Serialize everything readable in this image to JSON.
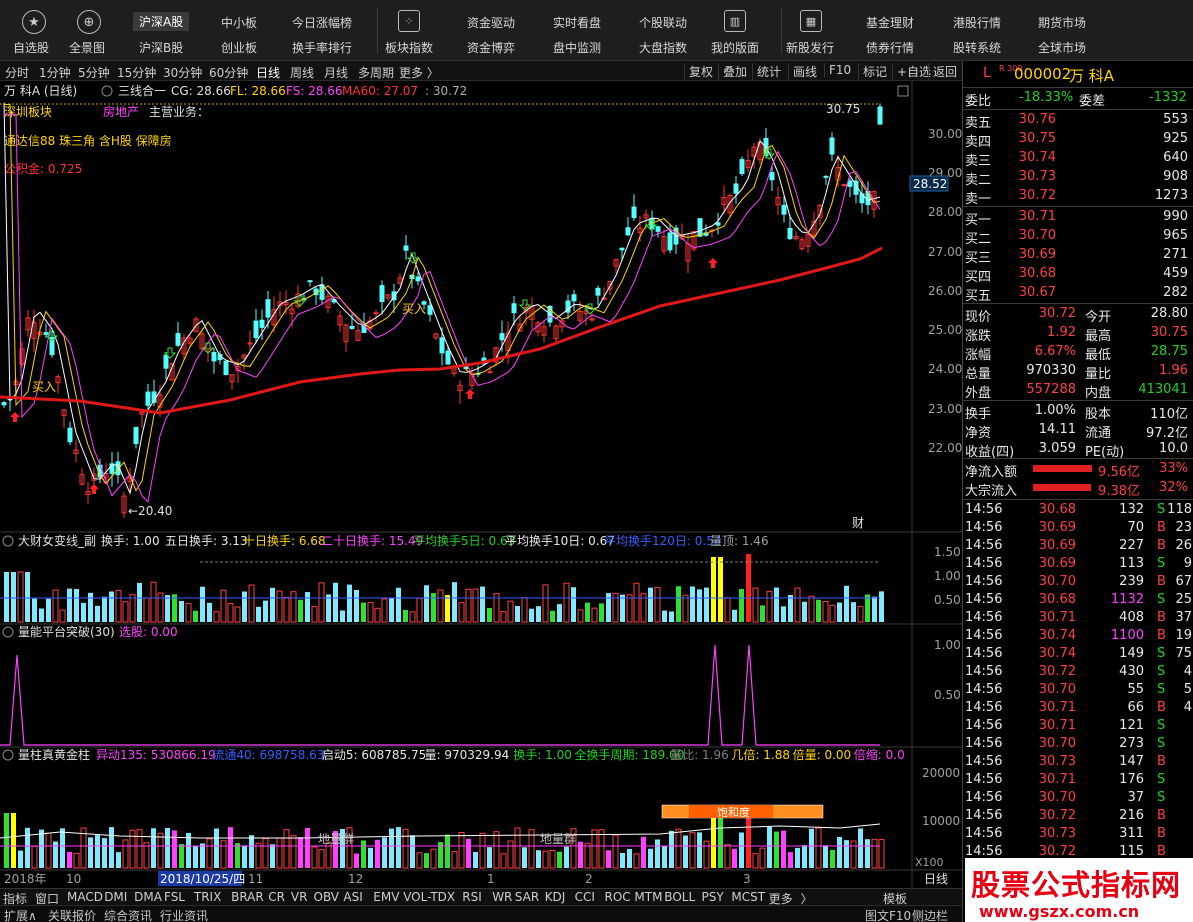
{
  "toolbar": {
    "row1": [
      "沪深A股",
      "中小板",
      "今日涨幅榜",
      "资金驱动",
      "实时看盘",
      "个股联动",
      "基金理财",
      "港股行情",
      "期货市场"
    ],
    "row2": [
      "自选股",
      "全景图",
      "沪深B股",
      "创业板",
      "换手率排行",
      "板块指数",
      "资金博弈",
      "盘中监测",
      "大盘指数",
      "我的版面",
      "新股发行",
      "债券行情",
      "股转系统",
      "全球市场"
    ]
  },
  "periods": [
    "分时",
    "1分钟",
    "5分钟",
    "15分钟",
    "30分钟",
    "60分钟",
    "日线",
    "周线",
    "月线",
    "多周期",
    "更多 〉"
  ],
  "period_active": "日线",
  "right_buttons": [
    "复权",
    "叠加",
    "统计",
    "画线",
    "F10",
    "标记",
    "+自选",
    "返回"
  ],
  "chart": {
    "name": "万 科A (日线)",
    "indicator": "三线合一",
    "cg": "CG: 28.66",
    "fl": "FL: 28.66",
    "fs": "FS: 28.66",
    "ma60": "MA60: 27.07",
    "extra": ": 30.72",
    "info_board": "深圳板块",
    "info_industry": "房地产",
    "info_business": "主营业务：",
    "info_concepts": "通达信88  珠三角  含H股  保障房",
    "info_fund": "公积金: 0.725",
    "price_axis": [
      "30.00",
      "29.00",
      "28.00",
      "27.00",
      "26.00",
      "25.00",
      "24.00",
      "23.00",
      "22.00"
    ],
    "current_price_tag": "28.52",
    "high_label": "30.75",
    "low_label": "←20.40",
    "buy_label": "买入",
    "cai_label": "财"
  },
  "panel1": {
    "title": "大财女变线_副",
    "items": [
      {
        "t": "换手: 1.00",
        "c": "#e8e8e8"
      },
      {
        "t": "五日换手: 3.13",
        "c": "#e8e8e8"
      },
      {
        "t": "十日换手: 6.68",
        "c": "#ffd400"
      },
      {
        "t": "二十日换手: 15.49",
        "c": "#ff40ff"
      },
      {
        "t": "平均换手5日: 0.63",
        "c": "#20d020"
      },
      {
        "t": "平均换手10日: 0.67",
        "c": "#e8e8e8"
      },
      {
        "t": "平均换手120日: 0.54",
        "c": "#3060ff"
      },
      {
        "t": "量顶: 1.46",
        "c": "#a0a0a0"
      }
    ],
    "axis": [
      "1.50",
      "1.00",
      "0.50"
    ]
  },
  "panel2": {
    "title": "量能平台突破(30)",
    "sel": "选股: 0.00",
    "axis": [
      "1.00",
      "0.50"
    ]
  },
  "panel3": {
    "title": "量柱真黄金柱",
    "items": [
      {
        "t": "异动135: 530866.19",
        "c": "#ff40ff"
      },
      {
        "t": "流通40: 698758.63",
        "c": "#3060ff"
      },
      {
        "t": "启动5: 608785.75",
        "c": "#e8e8e8"
      },
      {
        "t": "量: 970329.94",
        "c": "#e8e8e8"
      },
      {
        "t": "换手: 1.00",
        "c": "#20d020"
      },
      {
        "t": "全换手周期: 189.00",
        "c": "#20d020"
      },
      {
        "t": "量比: 1.96",
        "c": "#808080"
      },
      {
        "t": "几倍: 1.88",
        "c": "#ffd400"
      },
      {
        "t": "倍量: 0.00",
        "c": "#ffd400"
      },
      {
        "t": "倍缩: 0.0",
        "c": "#ff40ff"
      }
    ],
    "axis": [
      "20000",
      "10000"
    ],
    "unit": "X100",
    "sat_label": "饱和度",
    "ground_label": "地量群"
  },
  "date_axis": {
    "labels": [
      "2018年",
      "10",
      "11",
      "12",
      "1",
      "2",
      "3"
    ],
    "cursor": "2018/10/25/四",
    "period": "日线"
  },
  "bottom_tabs": [
    "指标",
    "窗口",
    "MACD",
    "DMI",
    "DMA",
    "FSL",
    "TRIX",
    "BRAR",
    "CR",
    "VR",
    "OBV",
    "ASI",
    "EMV",
    "VOL-TDX",
    "RSI",
    "WR",
    "SAR",
    "KDJ",
    "CCI",
    "ROC",
    "MTM",
    "BOLL",
    "PSY",
    "MCST",
    "更多",
    "〉",
    "模板"
  ],
  "ext_tabs": [
    "扩展∧",
    "关联报价",
    "综合资讯",
    "行业资讯"
  ],
  "ext_right": [
    "图文F10",
    "侧边栏"
  ],
  "quote": {
    "code": "000002",
    "name": "万 科A",
    "market": "L",
    "hs": "R 300",
    "weibi_label": "委比",
    "weibi": "-18.33%",
    "weicha_label": "委差",
    "weicha": "-1332",
    "asks": [
      {
        "l": "卖五",
        "p": "30.76",
        "v": "553"
      },
      {
        "l": "卖四",
        "p": "30.75",
        "v": "925"
      },
      {
        "l": "卖三",
        "p": "30.74",
        "v": "640"
      },
      {
        "l": "卖二",
        "p": "30.73",
        "v": "908"
      },
      {
        "l": "卖一",
        "p": "30.72",
        "v": "1273"
      }
    ],
    "bids": [
      {
        "l": "买一",
        "p": "30.71",
        "v": "990"
      },
      {
        "l": "买二",
        "p": "30.70",
        "v": "965"
      },
      {
        "l": "买三",
        "p": "30.69",
        "v": "271"
      },
      {
        "l": "买四",
        "p": "30.68",
        "v": "459"
      },
      {
        "l": "买五",
        "p": "30.67",
        "v": "282"
      }
    ],
    "stats1": [
      {
        "a": "现价",
        "av": "30.72",
        "ac": "red",
        "b": "今开",
        "bv": "28.80",
        "bc": "wht"
      },
      {
        "a": "涨跌",
        "av": "1.92",
        "ac": "red",
        "b": "最高",
        "bv": "30.75",
        "bc": "red"
      },
      {
        "a": "涨幅",
        "av": "6.67%",
        "ac": "red",
        "b": "最低",
        "bv": "28.75",
        "bc": "grn"
      },
      {
        "a": "总量",
        "av": "970330",
        "ac": "wht",
        "b": "量比",
        "bv": "1.96",
        "bc": "red"
      },
      {
        "a": "外盘",
        "av": "557288",
        "ac": "red",
        "b": "内盘",
        "bv": "413041",
        "bc": "grn"
      }
    ],
    "stats2": [
      {
        "a": "换手",
        "av": "1.00%",
        "b": "股本",
        "bv": "110亿"
      },
      {
        "a": "净资",
        "av": "14.11",
        "b": "流通",
        "bv": "97.2亿"
      },
      {
        "a": "收益(四)",
        "av": "3.059",
        "b": "PE(动)",
        "bv": "10.0"
      }
    ],
    "flows": [
      {
        "l": "净流入额",
        "v": "9.56亿",
        "p": "33%",
        "w": 0.33
      },
      {
        "l": "大宗流入",
        "v": "9.38亿",
        "p": "32%",
        "w": 0.32
      }
    ],
    "ticks": [
      {
        "t": "14:56",
        "p": "30.68",
        "v": "132",
        "d": "S"
      },
      {
        "t": "14:56",
        "p": "30.69",
        "v": "70",
        "d": "B"
      },
      {
        "t": "14:56",
        "p": "30.69",
        "v": "227",
        "d": "B"
      },
      {
        "t": "14:56",
        "p": "30.69",
        "v": "113",
        "d": "S"
      },
      {
        "t": "14:56",
        "p": "30.70",
        "v": "239",
        "d": "B"
      },
      {
        "t": "14:56",
        "p": "30.68",
        "v": "1132",
        "d": "S"
      },
      {
        "t": "14:56",
        "p": "30.71",
        "v": "408",
        "d": "B"
      },
      {
        "t": "14:56",
        "p": "30.74",
        "v": "1100",
        "d": "B"
      },
      {
        "t": "14:56",
        "p": "30.74",
        "v": "149",
        "d": "S"
      },
      {
        "t": "14:56",
        "p": "30.72",
        "v": "430",
        "d": "S"
      },
      {
        "t": "14:56",
        "p": "30.70",
        "v": "55",
        "d": "S"
      },
      {
        "t": "14:56",
        "p": "30.71",
        "v": "66",
        "d": "B"
      },
      {
        "t": "14:56",
        "p": "30.71",
        "v": "121",
        "d": "S"
      },
      {
        "t": "14:56",
        "p": "30.70",
        "v": "273",
        "d": "S"
      },
      {
        "t": "14:56",
        "p": "30.73",
        "v": "147",
        "d": "B"
      },
      {
        "t": "14:56",
        "p": "30.71",
        "v": "176",
        "d": "S"
      },
      {
        "t": "14:56",
        "p": "30.70",
        "v": "37",
        "d": "S"
      },
      {
        "t": "14:56",
        "p": "30.72",
        "v": "216",
        "d": "B"
      },
      {
        "t": "14:56",
        "p": "30.73",
        "v": "311",
        "d": "B"
      },
      {
        "t": "14:56",
        "p": "30.72",
        "v": "115",
        "d": "B"
      }
    ],
    "tick_extra": [
      "118",
      "23",
      "26",
      "9",
      "67",
      "25",
      "37",
      "19",
      "75",
      "4",
      "5",
      "4"
    ]
  },
  "watermark": {
    "line1": "股票公式指标网",
    "line2": "www.gszx.com.cn"
  },
  "colors": {
    "up": "#ff3232",
    "down": "#54ffff",
    "ma60": "#e01818",
    "bg": "#000000"
  }
}
